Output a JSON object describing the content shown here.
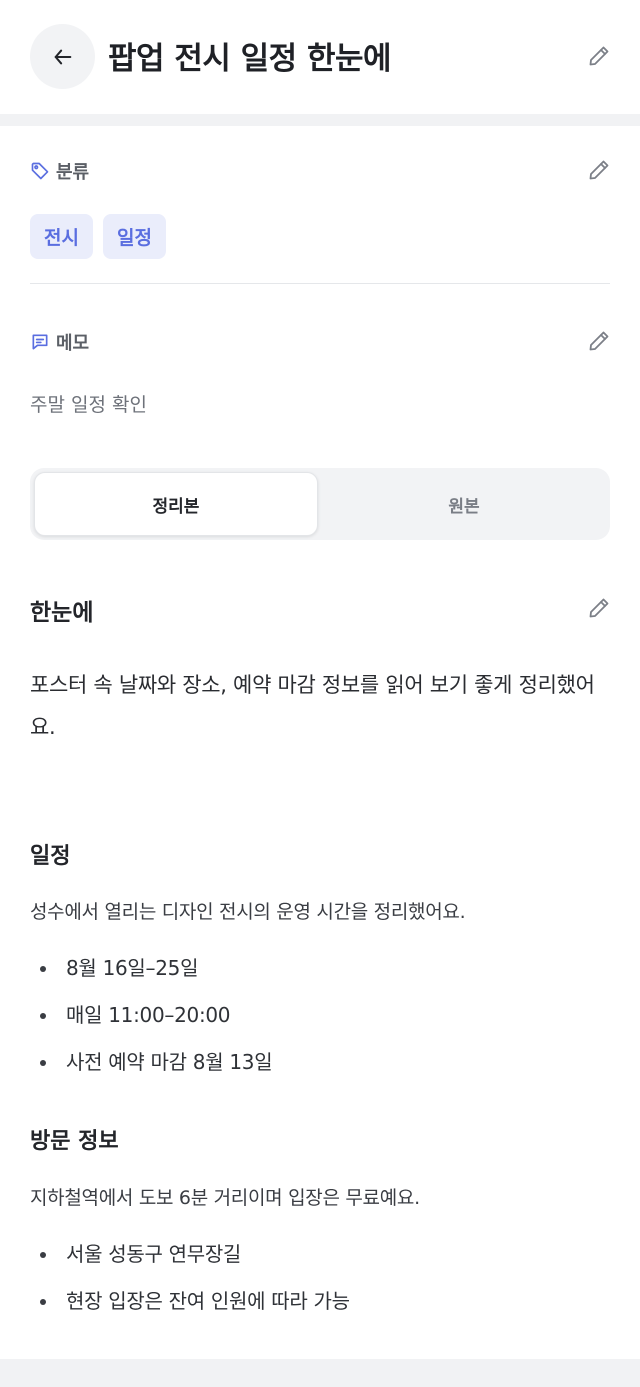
{
  "header": {
    "title": "팝업 전시 일정 한눈에"
  },
  "category": {
    "label": "분류",
    "tags": [
      "전시",
      "일정"
    ]
  },
  "memo": {
    "label": "메모",
    "text": "주말 일정 확인"
  },
  "view_toggle": {
    "options": [
      "정리본",
      "원본"
    ],
    "selected": "정리본"
  },
  "summary": {
    "title": "한눈에",
    "body": "포스터 속 날짜와 장소, 예약 마감 정보를 읽어 보기 좋게 정리했어요."
  },
  "sections": [
    {
      "title": "일정",
      "description": "성수에서 열리는 디자인 전시의 운영 시간을 정리했어요.",
      "bullets": [
        "8월 16일–25일",
        "매일 11:00–20:00",
        "사전 예약 마감 8월 13일"
      ]
    },
    {
      "title": "방문 정보",
      "description": "지하철역에서 도보 6분 거리이며 입장은 무료예요.",
      "bullets": [
        "서울 성동구 연무장길",
        "현장 입장은 잔여 인원에 따라 가능"
      ]
    }
  ],
  "colors": {
    "accent": "#5a6ee0",
    "tag_bg": "#eaedfb",
    "band": "#f1f2f4"
  },
  "icons": {
    "back": "arrow-left-icon",
    "edit": "pencil-icon",
    "category": "tag-icon",
    "memo": "message-icon"
  }
}
